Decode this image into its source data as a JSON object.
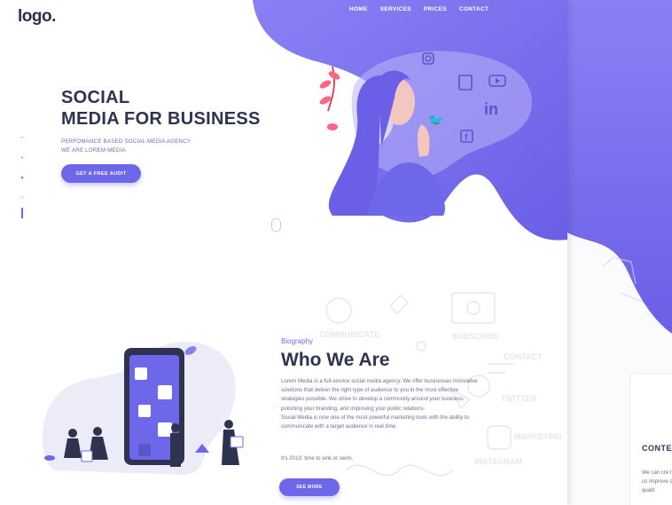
{
  "brand": {
    "logo": "logo."
  },
  "nav": {
    "items": [
      "HOME",
      "SERVICES",
      "PRICES",
      "CONTACT"
    ]
  },
  "hero": {
    "title_line1": "SOCIAL",
    "title_line2": "MEDIA FOR BUSINESS",
    "sub_line1": "PERFOMANCE BASED SOCIAL MEDIA AGENCY",
    "sub_line2": "WE ARE LOREM MEDIA",
    "cta": "GET A FREE AUDIT"
  },
  "social_rail": {
    "icons": [
      "facebook-icon",
      "location-icon",
      "twitter-icon",
      "instagram-icon"
    ]
  },
  "biography": {
    "label": "Biography",
    "title": "Who We Are",
    "paragraph1": "Lorem Media is a full-service social media agency. We offer businesses innovative solutions that deliver the right type of audience to you in the most effective strategies possible. We strive to develop a community around your business, polishing your branding, and improving your public relations.",
    "paragraph2": "Social Media is now one of the most powerful marketing tools with the ability to communicate with a target audience in real time.",
    "tagline": "It's 2019: time to sink or swim.",
    "button": "SEE MORE"
  },
  "background_words": [
    "COMMUNICATE",
    "SUBSCRIBE",
    "CONTACT",
    "MARKETING",
    "INSTAGRAM",
    "TWITTER"
  ],
  "back_page": {
    "heading": "CONTEN",
    "text": "We can cre the best co Improve o and qualit"
  },
  "colors": {
    "accent": "#6d68e9",
    "dark_text": "#2e3350",
    "muted_text": "#6d7190",
    "blob": "#7b72f0"
  }
}
